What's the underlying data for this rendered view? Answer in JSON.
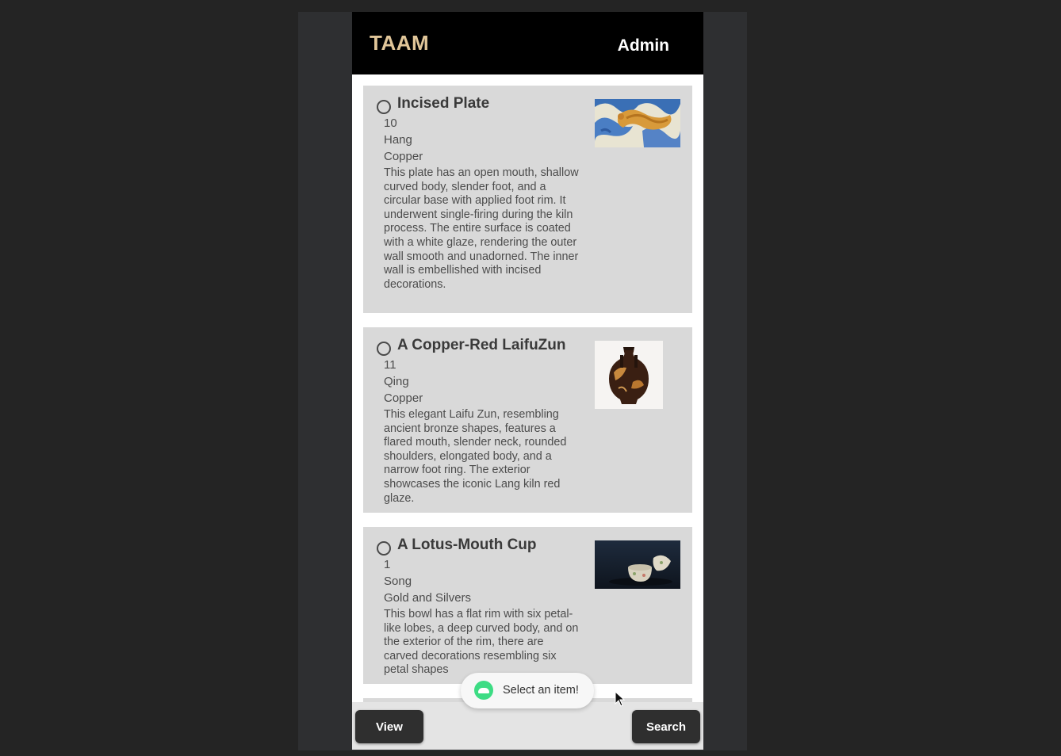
{
  "app": {
    "title": "TAAM",
    "user_role": "Admin"
  },
  "items": [
    {
      "title": "Incised Plate",
      "lot": "10",
      "period": "Hang",
      "category": "Copper",
      "description": "This plate has an open mouth, shallow curved body, slender foot, and a circular base with applied foot rim. It underwent single-firing during the kiln process. The entire surface is coated with a white glaze, rendering the outer wall smooth and unadorned. The inner wall is embellished with incised decorations.",
      "image": "blue-and-gold-dragon-porcelain-photo"
    },
    {
      "title": "A Copper-Red LaifuZun",
      "lot": "11",
      "period": "Qing",
      "category": "Copper",
      "description": "This elegant Laifu Zun, resembling ancient bronze shapes, features a flared mouth, slender neck, rounded shoulders, elongated body, and a narrow foot ring. The exterior showcases the iconic Lang kiln red glaze.",
      "image": "dark-glazed-vase-photo"
    },
    {
      "title": "A Lotus-Mouth Cup",
      "lot": "1",
      "period": "Song",
      "category": "Gold and Silvers",
      "description": "This bowl has a flat rim with six petal-like lobes, a deep curved body, and on the exterior of the rim, there are carved decorations resembling six petal shapes",
      "image": "lidded-cup-on-dark-background-photo"
    }
  ],
  "buttons": {
    "view": "View",
    "search": "Search"
  },
  "toast": {
    "message": "Select an item!",
    "icon": "android-robot-icon"
  },
  "colors": {
    "appbar": "#000000",
    "title": "#e1c699",
    "card": "#d9d9d9",
    "button": "#2f2f2f",
    "toast_icon": "#3ddc84"
  }
}
